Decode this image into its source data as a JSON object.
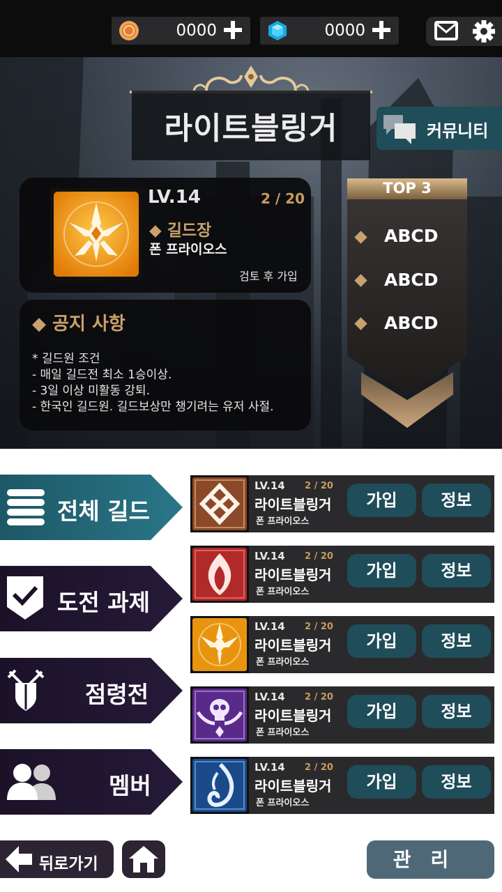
{
  "currency": {
    "coins": {
      "icon": "coin-icon",
      "value": "0000"
    },
    "gems": {
      "icon": "gem-icon",
      "value": "0000"
    }
  },
  "header_icons": [
    "mail-icon",
    "gear-icon"
  ],
  "guild": {
    "title": "라이트블링거",
    "community_label": "커뮤니티",
    "level": "LV.14",
    "members": "2 / 20",
    "role": "◆ 길드장",
    "leader": "폰 프라이오스",
    "join_type": "검토 후 가입",
    "notice_title": "◆ 공지 사항",
    "notice_lines": [
      "* 길드원 조건",
      "- 매일 길드전 최소 1승이상.",
      "- 3일 이상 미활동 강퇴.",
      "- 한국인 길드원. 길드보상만 챙기려는 유저 사절."
    ]
  },
  "top3": {
    "title": "TOP 3",
    "entries": [
      "ABCD",
      "ABCD",
      "ABCD"
    ]
  },
  "nav": [
    {
      "label": "전체 길드",
      "icon": "list-icon"
    },
    {
      "label": "도전 과제",
      "icon": "checkmark-icon"
    },
    {
      "label": "점령전",
      "icon": "crossed-swords-shield-icon"
    },
    {
      "label": "멤버",
      "icon": "members-icon"
    }
  ],
  "guild_list": [
    {
      "level": "LV.14",
      "members": "2 / 20",
      "name": "라이트블링거",
      "leader": "폰 프라이오스",
      "join": "가입",
      "info": "정보",
      "emblem": "knot-emblem-icon",
      "color": "#8a4a2a"
    },
    {
      "level": "LV.14",
      "members": "2 / 20",
      "name": "라이트블링거",
      "leader": "폰 프라이오스",
      "join": "가입",
      "info": "정보",
      "emblem": "flame-emblem-icon",
      "color": "#b02a2a"
    },
    {
      "level": "LV.14",
      "members": "2 / 20",
      "name": "라이트블링거",
      "leader": "폰 프라이오스",
      "join": "가입",
      "info": "정보",
      "emblem": "crown-emblem-icon",
      "color": "#e8940f"
    },
    {
      "level": "LV.14",
      "members": "2 / 20",
      "name": "라이트블링거",
      "leader": "폰 프라이오스",
      "join": "가입",
      "info": "정보",
      "emblem": "skull-emblem-icon",
      "color": "#5a2a8a"
    },
    {
      "level": "LV.14",
      "members": "2 / 20",
      "name": "라이트블링거",
      "leader": "폰 프라이오스",
      "join": "가입",
      "info": "정보",
      "emblem": "wave-emblem-icon",
      "color": "#1a4a8a"
    }
  ],
  "footer": {
    "back_label": "뒤로가기",
    "manage_label": "관리"
  }
}
